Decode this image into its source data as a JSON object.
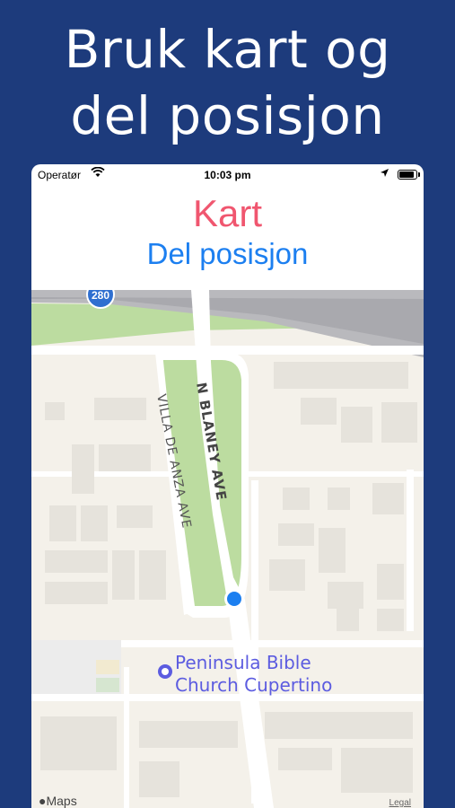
{
  "hero": {
    "line1": "Bruk kart og",
    "line2": "del posisjon"
  },
  "status": {
    "carrier": "Operatør",
    "time": "10:03 pm"
  },
  "header": {
    "title": "Kart",
    "share_link": "Del posisjon"
  },
  "map": {
    "highway_shield": "280",
    "street_blaney": "N BLANEY AVE",
    "street_villa": "VILLA DE ANZA AVE",
    "poi_line1": "Peninsula Bible",
    "poi_line2": "Church Cupertino",
    "brand": "Maps",
    "legal": "Legal"
  },
  "colors": {
    "background": "#1d3b7c",
    "title": "#f0566f",
    "link": "#1c7ff0",
    "poi": "#5c5ce0",
    "park": "#bcdca0"
  }
}
